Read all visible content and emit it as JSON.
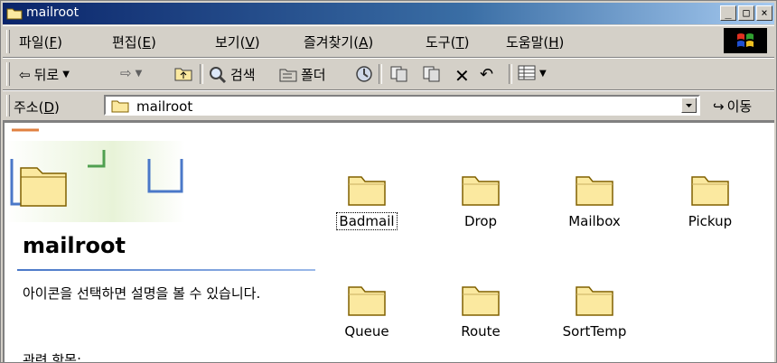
{
  "window": {
    "title": "mailroot"
  },
  "menu": {
    "items": [
      {
        "label": "파일",
        "key": "F"
      },
      {
        "label": "편집",
        "key": "E"
      },
      {
        "label": "보기",
        "key": "V"
      },
      {
        "label": "즐겨찾기",
        "key": "A"
      },
      {
        "label": "도구",
        "key": "T"
      },
      {
        "label": "도움말",
        "key": "H"
      }
    ]
  },
  "toolbar": {
    "back": "뒤로",
    "search": "검색",
    "folders": "폴더"
  },
  "address": {
    "label": "주소",
    "key": "D",
    "value": "mailroot",
    "go": "이동"
  },
  "side_panel": {
    "title": "mailroot",
    "description": "아이콘을 선택하면 설명을 볼 수 있습니다.",
    "related": "관련 항목:"
  },
  "folders": [
    {
      "name": "Badmail"
    },
    {
      "name": "Drop"
    },
    {
      "name": "Mailbox"
    },
    {
      "name": "Pickup"
    },
    {
      "name": "Queue"
    },
    {
      "name": "Route"
    },
    {
      "name": "SortTemp"
    }
  ],
  "colors": {
    "titlebar_start": "#0a246a",
    "titlebar_end": "#a6caf0",
    "folder": "#fbe9a0"
  }
}
